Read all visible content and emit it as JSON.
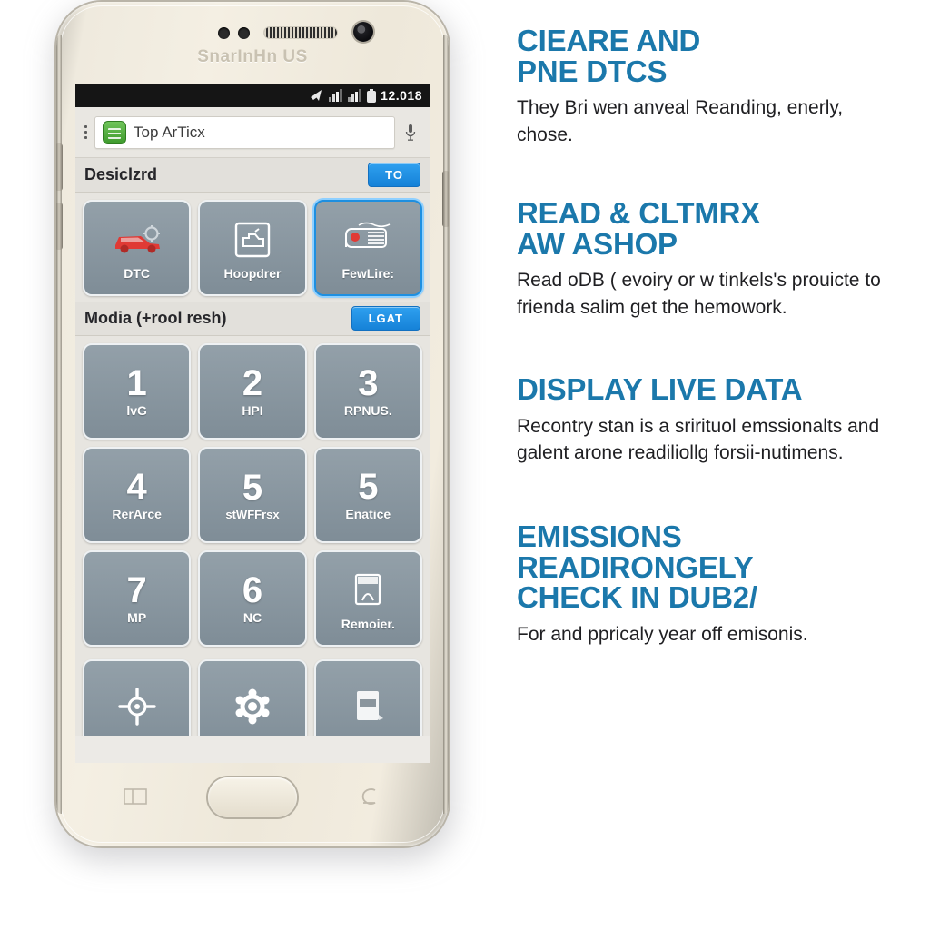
{
  "phone": {
    "brand_text": "SnarInHn US",
    "status_bar": {
      "clock": "12.018",
      "icons": [
        "wifi-icon",
        "signal-icon",
        "signal-icon",
        "battery-icon"
      ]
    },
    "search": {
      "value": "Top ArTicx",
      "app_icon": "green-app-icon",
      "mic_icon": "microphone-icon",
      "menu_icon": "overflow-menu-icon"
    },
    "section_1": {
      "title": "Desiclzrd",
      "button": "TO",
      "tiles": [
        {
          "label": "DTC",
          "icon": "red-car-icon",
          "selected": false
        },
        {
          "label": "Hoopdrer",
          "icon": "engine-bay-icon",
          "selected": false
        },
        {
          "label": "FewLire:",
          "icon": "fuel-gauge-icon",
          "selected": true
        }
      ]
    },
    "section_2": {
      "title": "Modia (+rool resh)",
      "button": "LGAT",
      "tiles": [
        {
          "num": "1",
          "label": "lvG",
          "icon": ""
        },
        {
          "num": "2",
          "label": "HPI",
          "icon": ""
        },
        {
          "num": "3",
          "label": "RPNUS.",
          "icon": ""
        },
        {
          "num": "4",
          "label": "RerArce",
          "icon": ""
        },
        {
          "num": "5",
          "label": "stWFFrsx",
          "icon": ""
        },
        {
          "num": "5",
          "label": "Enatice",
          "icon": ""
        },
        {
          "num": "7",
          "label": "MP",
          "icon": ""
        },
        {
          "num": "6",
          "label": "NC",
          "icon": ""
        },
        {
          "num": "",
          "label": "Remoier.",
          "icon": "document-icon"
        },
        {
          "num": "",
          "label": "",
          "icon": "crosshair-icon"
        },
        {
          "num": "",
          "label": "",
          "icon": "gear-icon"
        },
        {
          "num": "",
          "label": "",
          "icon": "file-icon"
        }
      ]
    },
    "nav": {
      "recents": "recents-key",
      "home": "home-button",
      "back": "back-key"
    }
  },
  "features": [
    {
      "heading_line1": "CIEARE AND",
      "heading_line2": "PNE DTCS",
      "body": "They Bri wen anveal Reanding, enerly, chose."
    },
    {
      "heading_line1": "READ & CLTMRX",
      "heading_line2": "AW ASHOP",
      "body": "Read oDB ( evoiry or w tinkels's prouicte to frienda salim get the hemowork."
    },
    {
      "heading_line1": "DISPLAY LIVE DATA",
      "heading_line2": "",
      "body": "Recontry stan is a srirituol emssionalts and galent arone readiliollg forsii-nutimens."
    },
    {
      "heading_line1": "EMISSIONS",
      "heading_line2": "READIRONGELY",
      "heading_line3": "CHECK IN DUB2/",
      "body": "For and ppricaly year off emisonis."
    }
  ],
  "colors": {
    "heading_blue": "#1b78ab",
    "accent_blue": "#1e8fe0",
    "tile_gray": "#879099",
    "body_text": "#1f1f22"
  }
}
